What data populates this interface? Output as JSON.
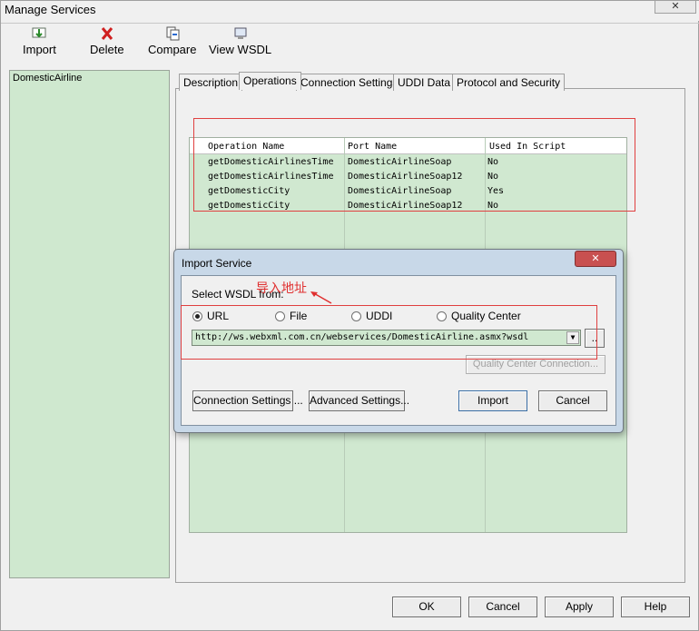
{
  "window": {
    "title": "Manage Services",
    "close": "✕"
  },
  "toolbar": {
    "import_label": "Import",
    "delete_label": "Delete",
    "compare_label": "Compare",
    "view_wsdl_label": "View WSDL"
  },
  "sidebar": {
    "items": [
      {
        "label": "DomesticAirline"
      }
    ]
  },
  "tabs": [
    {
      "label": "Description"
    },
    {
      "label": "Operations"
    },
    {
      "label": "Connection Settings"
    },
    {
      "label": "UDDI Data"
    },
    {
      "label": "Protocol and Security"
    }
  ],
  "operations_table": {
    "headers": [
      "Operation Name",
      "Port Name",
      "Used In Script"
    ],
    "rows": [
      [
        "getDomesticAirlinesTime",
        "DomesticAirlineSoap",
        "No"
      ],
      [
        "getDomesticAirlinesTime",
        "DomesticAirlineSoap12",
        "No"
      ],
      [
        "getDomesticCity",
        "DomesticAirlineSoap",
        "Yes"
      ],
      [
        "getDomesticCity",
        "DomesticAirlineSoap12",
        "No"
      ]
    ]
  },
  "dialog": {
    "title": "Import Service",
    "close": "✕",
    "select_label": "Select WSDL from:",
    "annotation": "导入地址",
    "options": [
      {
        "label": "URL",
        "selected": true
      },
      {
        "label": "File",
        "selected": false
      },
      {
        "label": "UDDI",
        "selected": false
      },
      {
        "label": "Quality Center",
        "selected": false
      }
    ],
    "url_value": "http://ws.webxml.com.cn/webservices/DomesticAirline.asmx?wsdl",
    "browse_label": "..",
    "qc_connection_label": "Quality Center Connection...",
    "connection_settings_label": "Connection Settings ...",
    "advanced_settings_label": "Advanced Settings...",
    "import_label": "Import",
    "cancel_label": "Cancel"
  },
  "footer": {
    "ok_label": "OK",
    "cancel_label": "Cancel",
    "apply_label": "Apply",
    "help_label": "Help"
  },
  "colors": {
    "grid_bg": "#d0e8d0",
    "annotation_red": "#e03030",
    "dialog_frame": "#c8d8e8"
  }
}
